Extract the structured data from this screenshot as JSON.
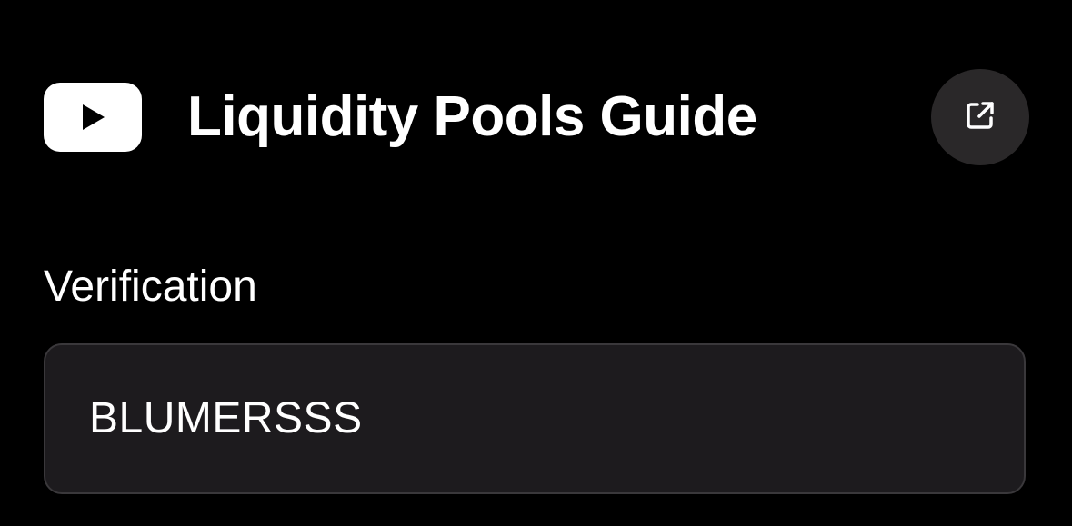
{
  "header": {
    "title": "Liquidity Pools Guide",
    "logo_icon": "youtube-icon",
    "action_icon": "external-link-icon"
  },
  "verification": {
    "label": "Verification",
    "value": "BLUMERSSS"
  },
  "colors": {
    "background": "#000000",
    "text": "#ffffff",
    "button_bg": "#2a2829",
    "field_bg": "#1d1b1e",
    "field_border": "#3a383b"
  }
}
